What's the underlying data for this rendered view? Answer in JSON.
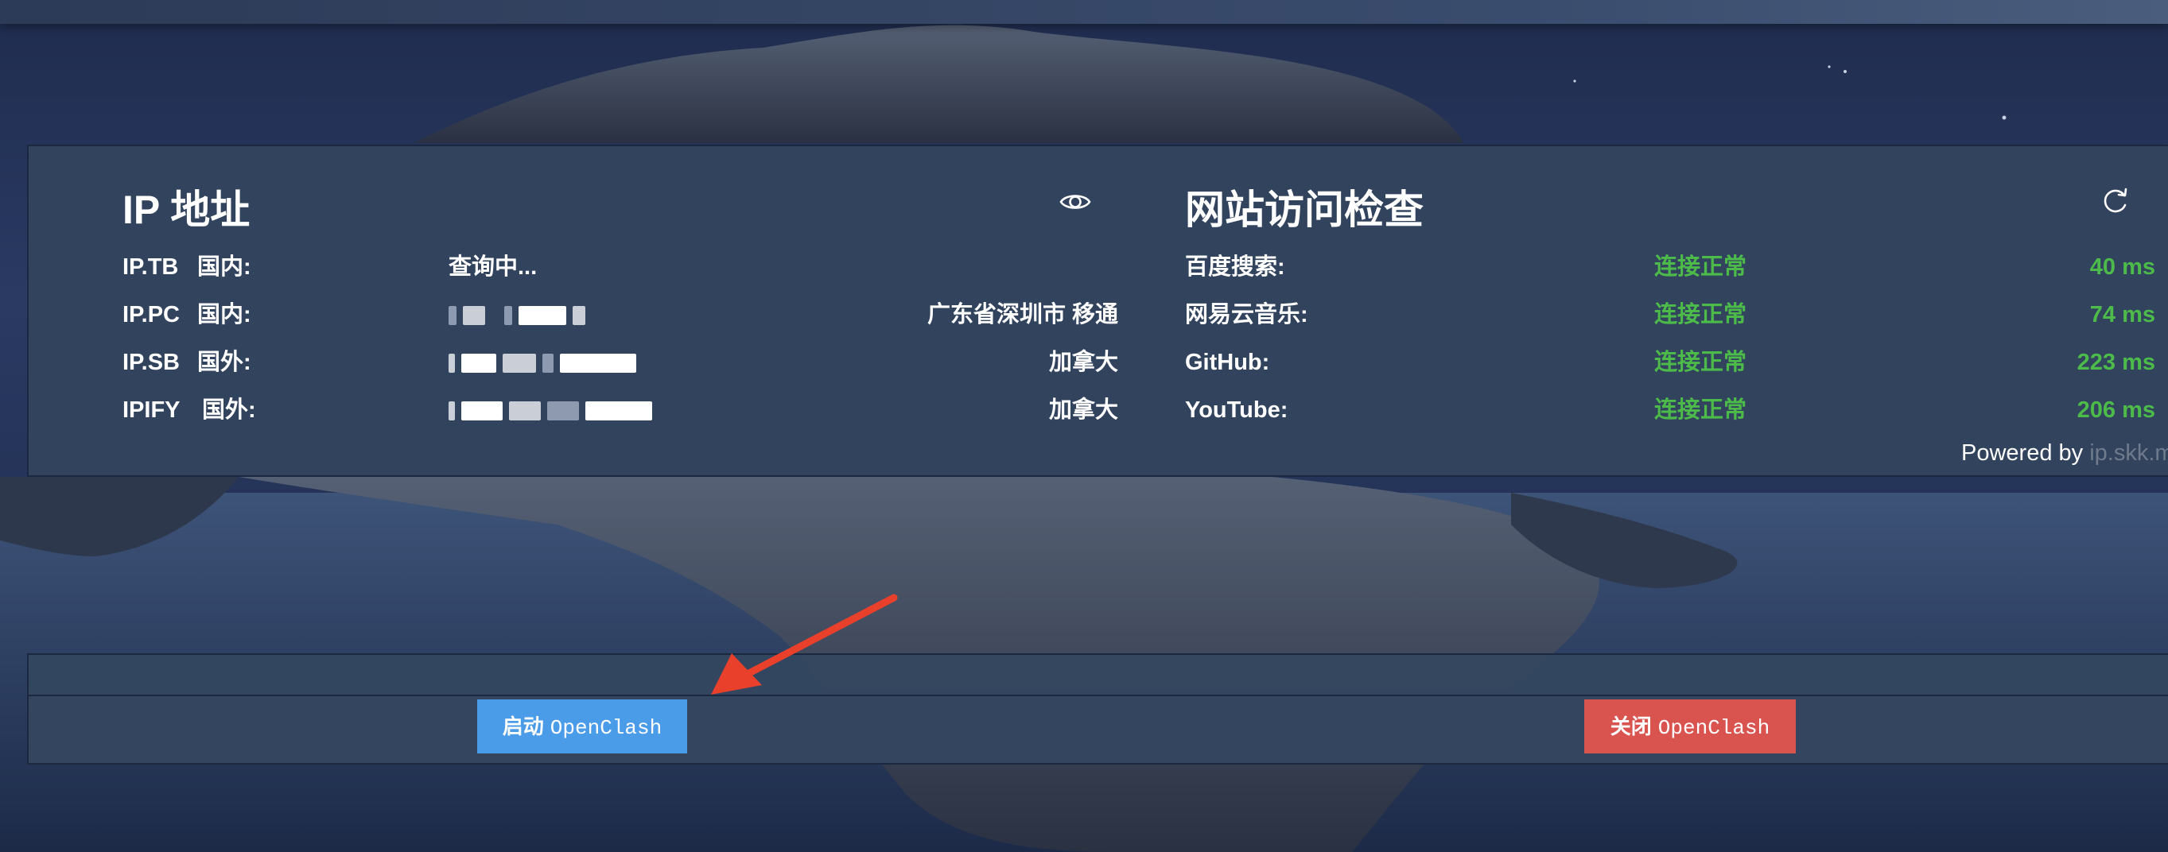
{
  "ip_panel": {
    "title": "IP 地址",
    "rows": [
      {
        "source": "IP.TB",
        "scope": "国内:",
        "ip": "查询中...",
        "location": ""
      },
      {
        "source": "IP.PC",
        "scope": "国内:",
        "ip": "",
        "location": "广东省深圳市 移通"
      },
      {
        "source": "IP.SB",
        "scope": "国外:",
        "ip": "",
        "location": "加拿大"
      },
      {
        "source": "IPIFY",
        "scope": "国外:",
        "ip": "",
        "location": "加拿大"
      }
    ]
  },
  "site_panel": {
    "title": "网站访问检查",
    "sites": [
      {
        "name": "百度搜索:",
        "status": "连接正常",
        "latency": "40 ms"
      },
      {
        "name": "网易云音乐:",
        "status": "连接正常",
        "latency": "74 ms"
      },
      {
        "name": "GitHub:",
        "status": "连接正常",
        "latency": "223 ms"
      },
      {
        "name": "YouTube:",
        "status": "连接正常",
        "latency": "206 ms"
      }
    ]
  },
  "footer": {
    "powered_label": "Powered by",
    "powered_link": "ip.skk.mo"
  },
  "controls": {
    "start_zh": "启动",
    "start_name": "OpenClash",
    "stop_zh": "关闭",
    "stop_name": "OpenClash"
  },
  "colors": {
    "status_ok": "#4cbb4a",
    "start_button": "#4a9be8",
    "stop_button": "#d9534f",
    "annotation_arrow": "#e8402b"
  },
  "icons": {
    "privacy_toggle": "eye-icon",
    "refresh": "refresh-icon"
  }
}
